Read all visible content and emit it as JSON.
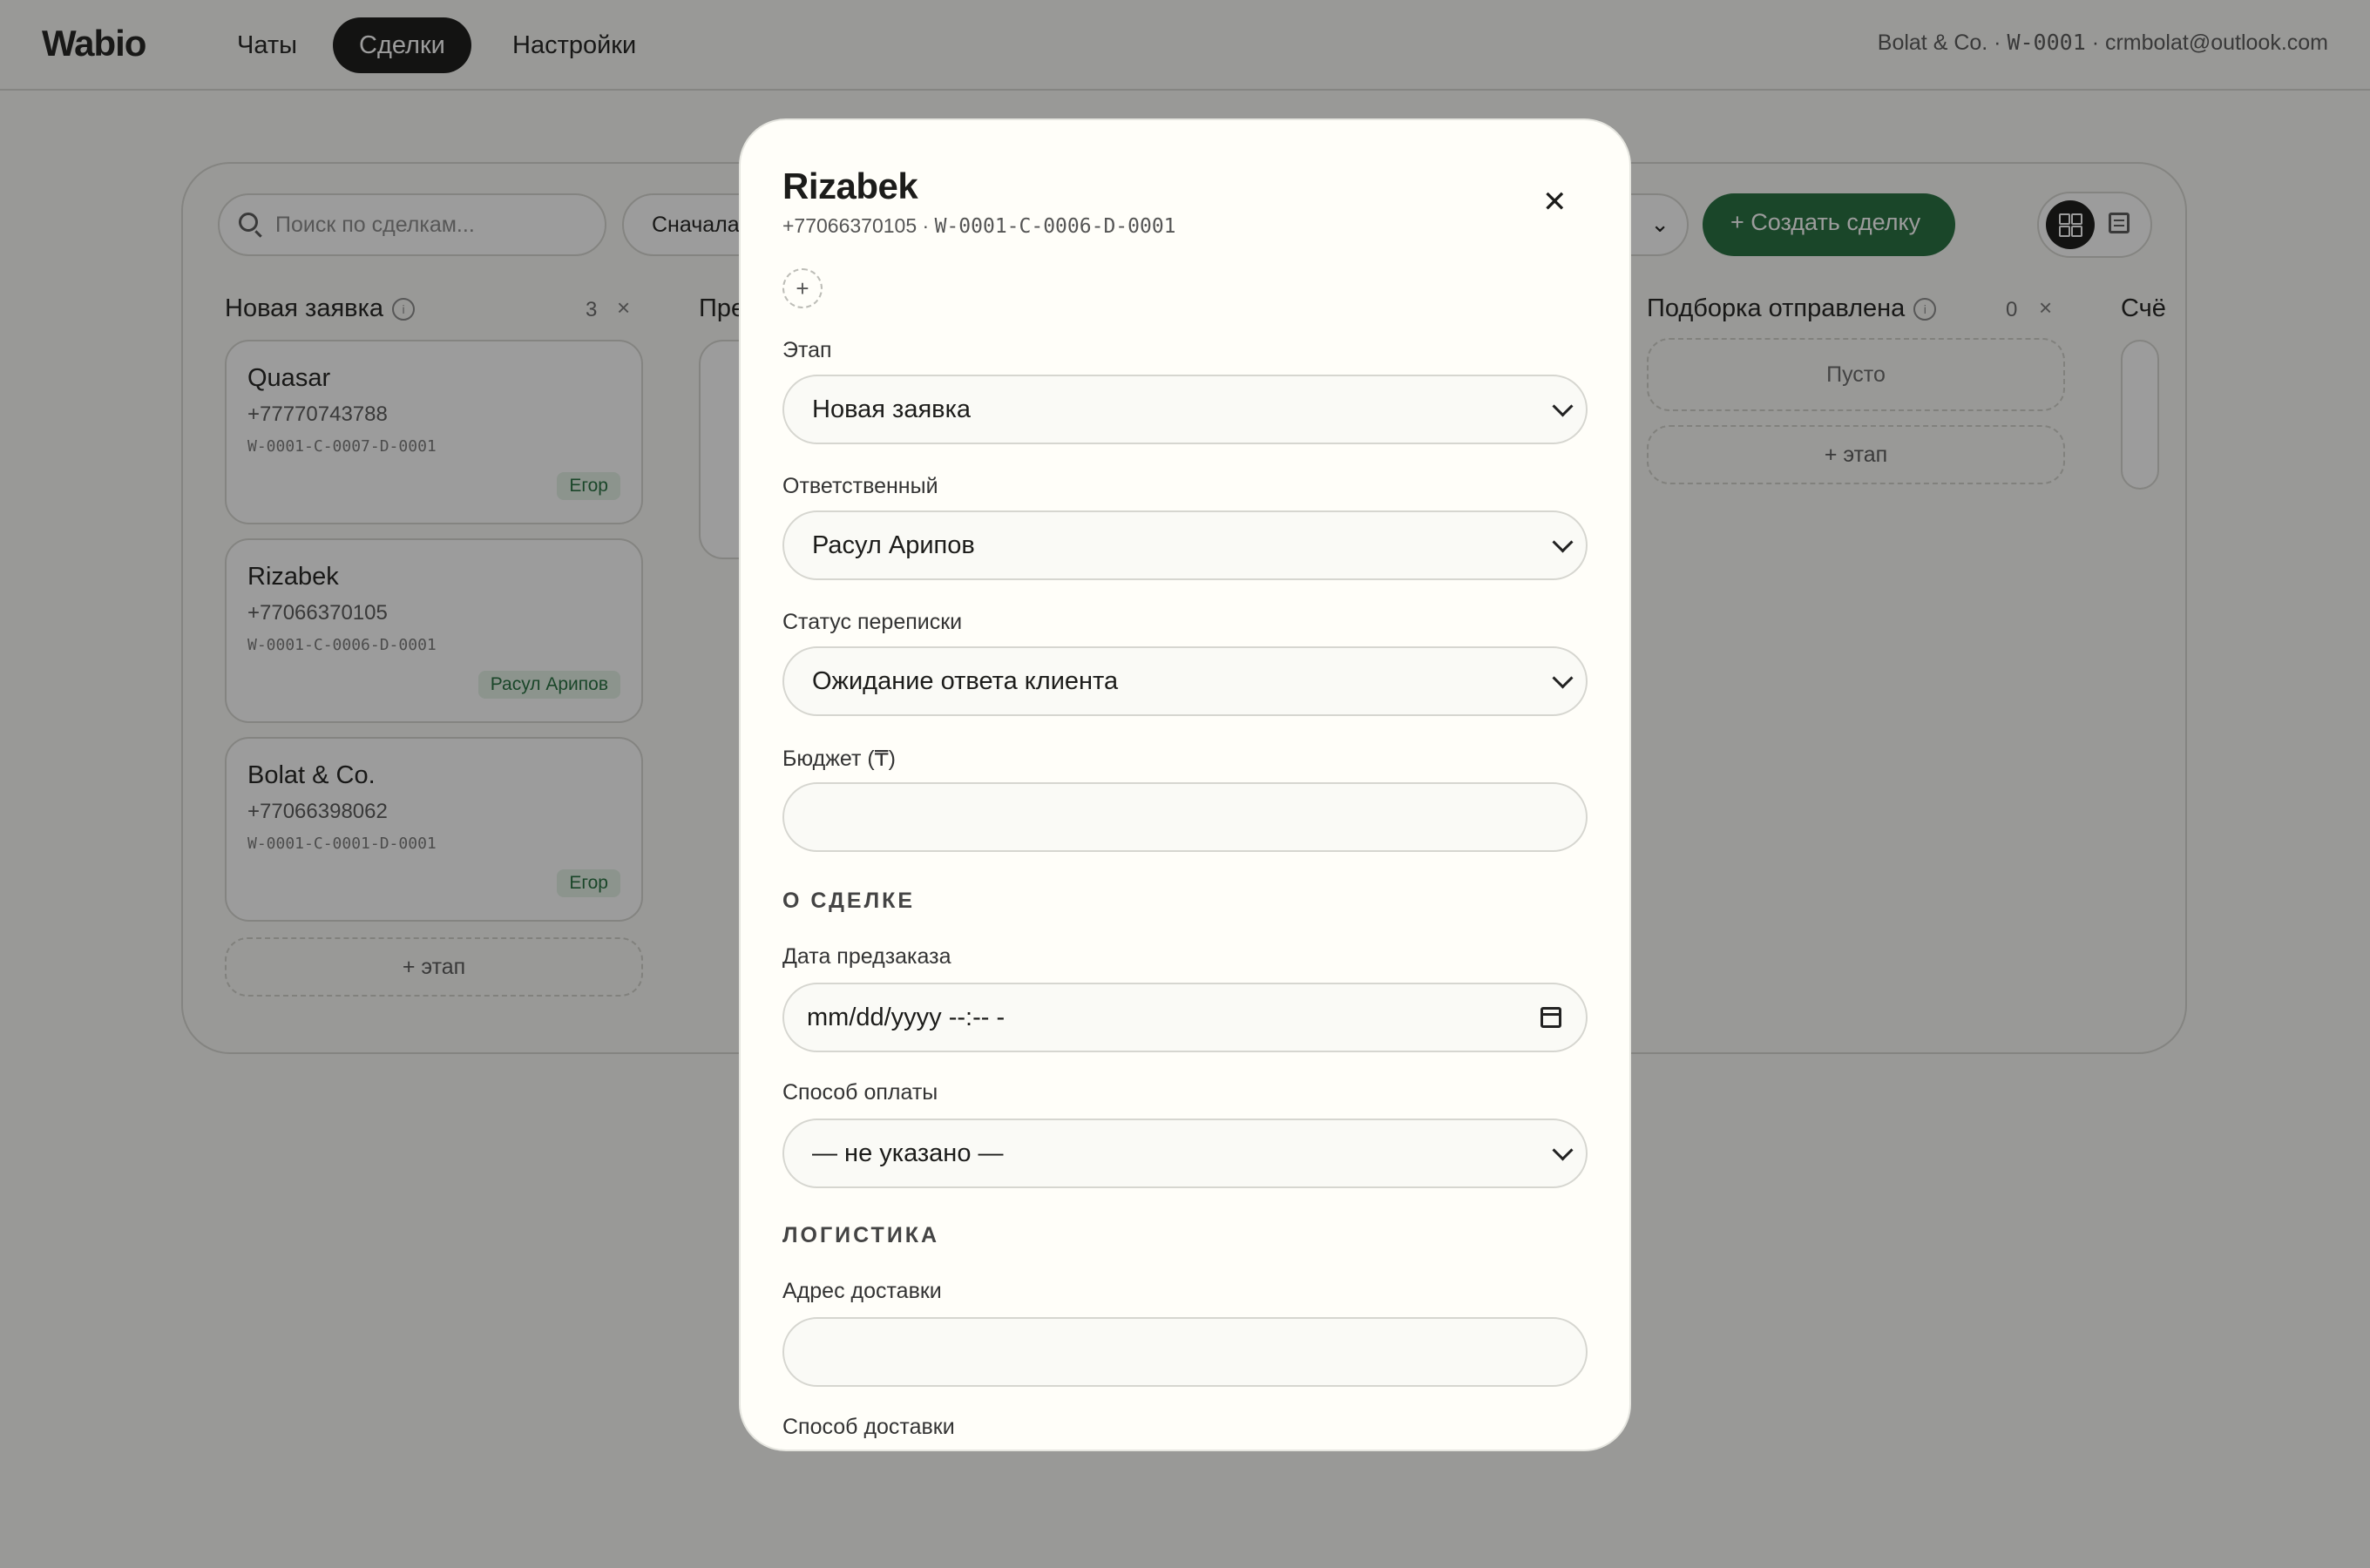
{
  "app": {
    "logo": "Wabio",
    "nav": [
      "Чаты",
      "Сделки",
      "Настройки"
    ],
    "account_name": "Bolat & Co. · ",
    "account_id": "W-0001",
    "account_email": " · crmbolat@outlook.com"
  },
  "toolbar": {
    "search_placeholder": "Поиск по сделкам...",
    "sort_label": "Сначала",
    "create_label": "+ Создать сделку"
  },
  "columns": [
    {
      "title": "Новая заявка",
      "count": "3",
      "cards": [
        {
          "name": "Quasar",
          "phone": "+77770743788",
          "code": "W-0001-C-0007-D-0001",
          "tag": "Егор"
        },
        {
          "name": "Rizabek",
          "phone": "+77066370105",
          "code": "W-0001-C-0006-D-0001",
          "tag": "Расул Арипов"
        },
        {
          "name": "Bolat & Co.",
          "phone": "+77066398062",
          "code": "W-0001-C-0001-D-0001",
          "tag": "Егор"
        }
      ],
      "add_stage": "+ этап"
    },
    {
      "title": "Пре"
    },
    {
      "title": "Подборка отправлена",
      "count": "0",
      "empty": "Пусто",
      "add_stage": "+ этап"
    },
    {
      "title": "Счё"
    }
  ],
  "modal": {
    "title": "Rizabek",
    "phone": "+77066370105 · ",
    "code": "W-0001-C-0006-D-0001",
    "add_symbol": "+",
    "close_symbol": "✕",
    "fields": {
      "stage_label": "Этап",
      "stage_value": "Новая заявка",
      "owner_label": "Ответственный",
      "owner_value": "Расул Арипов",
      "chat_status_label": "Статус переписки",
      "chat_status_value": "Ожидание ответа клиента",
      "budget_label": "Бюджет (₸)",
      "budget_value": "",
      "section_deal": "О СДЕЛКЕ",
      "preorder_label": "Дата предзаказа",
      "preorder_value": "mm/dd/yyyy --:-- -",
      "payment_label": "Способ оплаты",
      "payment_value": "— не указано —",
      "section_logistics": "ЛОГИСТИКА",
      "address_label": "Адрес доставки",
      "address_value": "",
      "delivery_label": "Способ доставки"
    }
  }
}
